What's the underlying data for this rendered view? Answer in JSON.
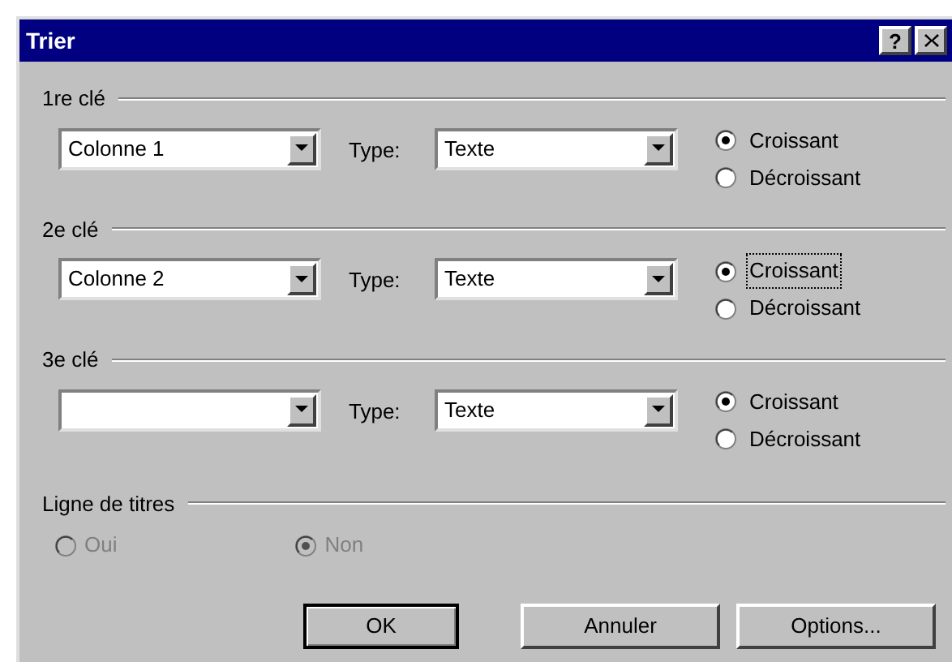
{
  "window": {
    "title": "Trier",
    "buttons": [
      {
        "kind": "help",
        "label": "?"
      },
      {
        "kind": "close"
      }
    ]
  },
  "keys": [
    {
      "title": "1re clé",
      "column": {
        "value": "Colonne 1"
      },
      "type_label": "Type:",
      "type": {
        "value": "Texte"
      },
      "orders": [
        {
          "label": "Croissant",
          "selected": true,
          "focused": false
        },
        {
          "label": "Décroissant",
          "selected": false,
          "focused": false
        }
      ]
    },
    {
      "title": "2e clé",
      "column": {
        "value": "Colonne 2"
      },
      "type_label": "Type:",
      "type": {
        "value": "Texte"
      },
      "orders": [
        {
          "label": "Croissant",
          "selected": true,
          "focused": true
        },
        {
          "label": "Décroissant",
          "selected": false,
          "focused": false
        }
      ]
    },
    {
      "title": "3e clé",
      "type_label": "Type:",
      "type": {
        "value": "Texte"
      },
      "orders": [
        {
          "label": "Croissant",
          "selected": true,
          "focused": false
        },
        {
          "label": "Décroissant",
          "selected": false,
          "focused": false
        }
      ]
    }
  ],
  "header_row": {
    "title": "Ligne de titres",
    "options": [
      {
        "label": "Oui",
        "selected": false,
        "disabled": true
      },
      {
        "label": "Non",
        "selected": true,
        "disabled": true
      }
    ]
  },
  "buttons": [
    {
      "label": "OK",
      "default": true
    },
    {
      "label": "Annuler",
      "default": false
    },
    {
      "label": "Options...",
      "default": false
    }
  ]
}
